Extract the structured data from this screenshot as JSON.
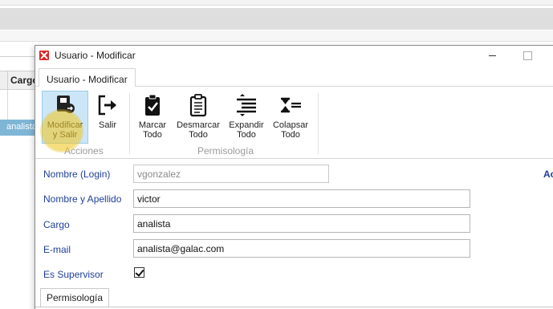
{
  "background_app": {
    "column_header": "Cargo",
    "selected_row": "analista"
  },
  "window": {
    "title": "Usuario - Modificar"
  },
  "tabs": [
    "Usuario - Modificar"
  ],
  "ribbon": {
    "groups": [
      {
        "label": "Acciones",
        "buttons": [
          {
            "label_line1": "Modificar",
            "label_line2": "y Salir",
            "icon": "save-exit-icon",
            "active": true
          },
          {
            "label_line1": "Salir",
            "label_line2": "",
            "icon": "exit-arrow-icon"
          }
        ]
      },
      {
        "label": "Permisología",
        "buttons": [
          {
            "label_line1": "Marcar",
            "label_line2": "Todo",
            "icon": "clipboard-check-icon"
          },
          {
            "label_line1": "Desmarcar",
            "label_line2": "Todo",
            "icon": "clipboard-list-icon"
          },
          {
            "label_line1": "Expandir",
            "label_line2": "Todo",
            "icon": "expand-lines-icon"
          },
          {
            "label_line1": "Colapsar",
            "label_line2": "Todo",
            "icon": "collapse-lines-icon"
          }
        ]
      }
    ]
  },
  "form": {
    "login_label": "Nombre (Login)",
    "login_value": "vgonzalez",
    "fullname_label": "Nombre y Apellido",
    "fullname_value": "victor",
    "cargo_label": "Cargo",
    "cargo_value": "analista",
    "email_label": "E-mail",
    "email_value": "analista@galac.com",
    "supervisor_label": "Es Supervisor",
    "supervisor_checked": true,
    "right_cut_text": "Ac"
  },
  "subtabs": [
    "Permisología"
  ],
  "colors": {
    "label_blue": "#1f3f99",
    "active_button_bg": "#cde6f7",
    "selected_row_bg": "#7fb5d5",
    "cursor_highlight": "#f0c828"
  }
}
